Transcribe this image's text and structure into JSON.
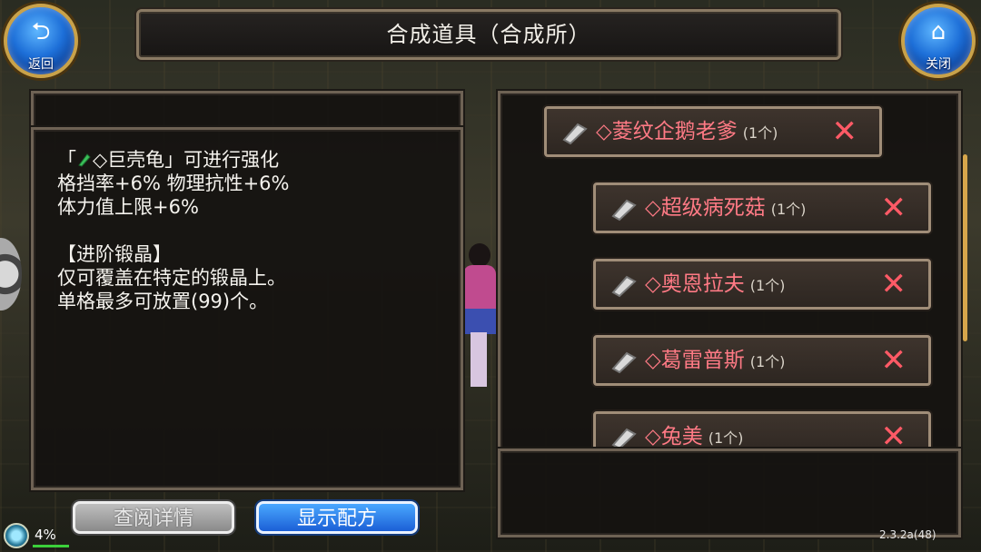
{
  "header": {
    "title": "合成道具（合成所）",
    "back_label": "返回",
    "close_label": "关闭"
  },
  "description": {
    "line1_prefix": "「",
    "line1_item": "◇巨壳龟",
    "line1_suffix": "」可进行强化",
    "line2": "格挡率+6% 物理抗性+6%",
    "line3": "体力值上限+6%",
    "line4": "【进阶锻晶】",
    "line5": "仅可覆盖在特定的锻晶上。",
    "line6": "单格最多可放置(99)个。"
  },
  "materials": [
    {
      "name": "◇菱纹企鹅老爹",
      "qty": "(1个)"
    },
    {
      "name": "◇超级病死菇",
      "qty": "(1个)"
    },
    {
      "name": "◇奥恩拉夫",
      "qty": "(1个)"
    },
    {
      "name": "◇葛雷普斯",
      "qty": "(1个)"
    },
    {
      "name": "◇兔美",
      "qty": "(1个)"
    }
  ],
  "remove_symbol": "✕",
  "buttons": {
    "details": "查阅详情",
    "recipe": "显示配方"
  },
  "status": {
    "percent": "4%",
    "version": "2.3.2a(48)"
  },
  "colors": {
    "item_name": "#ff7a85",
    "accent_blue": "#1d6fd8",
    "frame": "#8a7a64"
  }
}
